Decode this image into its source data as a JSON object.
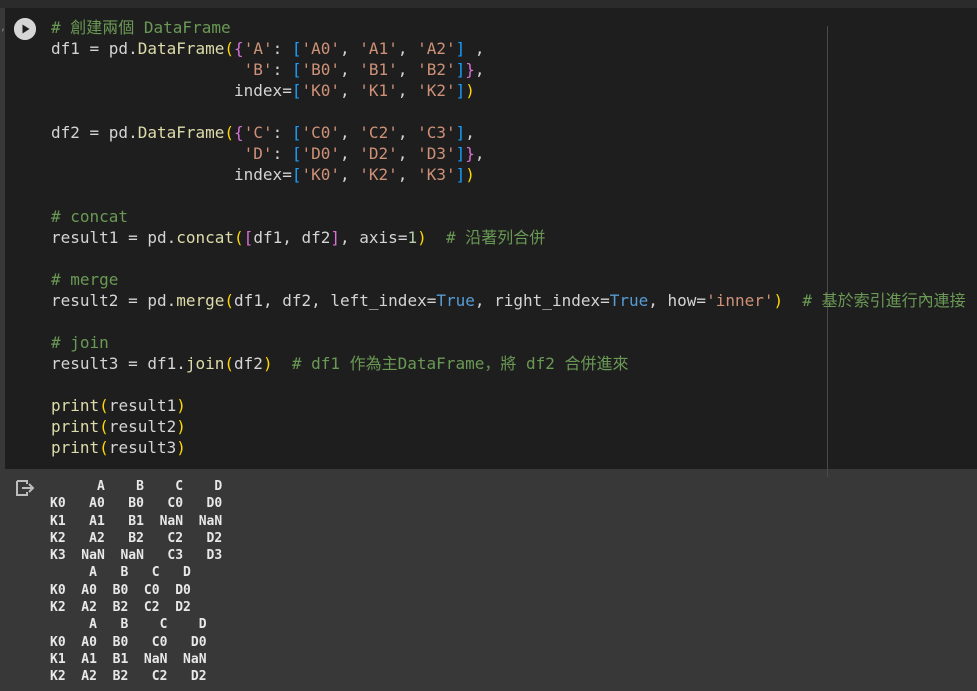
{
  "cell": {
    "code_lines": [
      [
        [
          "c",
          "# 創建兩個 DataFrame"
        ]
      ],
      [
        [
          "",
          "df1 = pd."
        ],
        [
          "f",
          "DataFrame"
        ],
        [
          "y",
          "("
        ],
        [
          "m",
          "{"
        ],
        [
          "s",
          "'A'"
        ],
        [
          "",
          ": "
        ],
        [
          "b",
          "["
        ],
        [
          "s",
          "'A0'"
        ],
        [
          "",
          ", "
        ],
        [
          "s",
          "'A1'"
        ],
        [
          "",
          ", "
        ],
        [
          "s",
          "'A2'"
        ],
        [
          "b",
          "]"
        ],
        [
          "",
          " ,"
        ]
      ],
      [
        [
          "",
          "                    "
        ],
        [
          "s",
          "'B'"
        ],
        [
          "",
          ": "
        ],
        [
          "b",
          "["
        ],
        [
          "s",
          "'B0'"
        ],
        [
          "",
          ", "
        ],
        [
          "s",
          "'B1'"
        ],
        [
          "",
          ", "
        ],
        [
          "s",
          "'B2'"
        ],
        [
          "b",
          "]"
        ],
        [
          "m",
          "}"
        ],
        [
          "",
          ","
        ]
      ],
      [
        [
          "",
          "                   index="
        ],
        [
          "b",
          "["
        ],
        [
          "s",
          "'K0'"
        ],
        [
          "",
          ", "
        ],
        [
          "s",
          "'K1'"
        ],
        [
          "",
          ", "
        ],
        [
          "s",
          "'K2'"
        ],
        [
          "b",
          "]"
        ],
        [
          "y",
          ")"
        ]
      ],
      [],
      [
        [
          "",
          "df2 = pd."
        ],
        [
          "f",
          "DataFrame"
        ],
        [
          "y",
          "("
        ],
        [
          "m",
          "{"
        ],
        [
          "s",
          "'C'"
        ],
        [
          "",
          ": "
        ],
        [
          "b",
          "["
        ],
        [
          "s",
          "'C0'"
        ],
        [
          "",
          ", "
        ],
        [
          "s",
          "'C2'"
        ],
        [
          "",
          ", "
        ],
        [
          "s",
          "'C3'"
        ],
        [
          "b",
          "]"
        ],
        [
          "",
          ","
        ]
      ],
      [
        [
          "",
          "                    "
        ],
        [
          "s",
          "'D'"
        ],
        [
          "",
          ": "
        ],
        [
          "b",
          "["
        ],
        [
          "s",
          "'D0'"
        ],
        [
          "",
          ", "
        ],
        [
          "s",
          "'D2'"
        ],
        [
          "",
          ", "
        ],
        [
          "s",
          "'D3'"
        ],
        [
          "b",
          "]"
        ],
        [
          "m",
          "}"
        ],
        [
          "",
          ","
        ]
      ],
      [
        [
          "",
          "                   index="
        ],
        [
          "b",
          "["
        ],
        [
          "s",
          "'K0'"
        ],
        [
          "",
          ", "
        ],
        [
          "s",
          "'K2'"
        ],
        [
          "",
          ", "
        ],
        [
          "s",
          "'K3'"
        ],
        [
          "b",
          "]"
        ],
        [
          "y",
          ")"
        ]
      ],
      [],
      [
        [
          "c",
          "# concat"
        ]
      ],
      [
        [
          "",
          "result1 = pd."
        ],
        [
          "f",
          "concat"
        ],
        [
          "y",
          "("
        ],
        [
          "m",
          "["
        ],
        [
          "",
          "df1, df2"
        ],
        [
          "m",
          "]"
        ],
        [
          "",
          ", axis="
        ],
        [
          "n",
          "1"
        ],
        [
          "y",
          ")"
        ],
        [
          "",
          "  "
        ],
        [
          "c",
          "# 沿著列合併"
        ]
      ],
      [],
      [
        [
          "c",
          "# merge"
        ]
      ],
      [
        [
          "",
          "result2 = pd."
        ],
        [
          "f",
          "merge"
        ],
        [
          "y",
          "("
        ],
        [
          "",
          "df1, df2, left_index="
        ],
        [
          "k",
          "True"
        ],
        [
          "",
          ", right_index="
        ],
        [
          "k",
          "True"
        ],
        [
          "",
          ", how="
        ],
        [
          "s",
          "'inner'"
        ],
        [
          "y",
          ")"
        ],
        [
          "",
          "  "
        ],
        [
          "c",
          "# 基於索引進行內連接"
        ]
      ],
      [],
      [
        [
          "c",
          "# join"
        ]
      ],
      [
        [
          "",
          "result3 = df1."
        ],
        [
          "f",
          "join"
        ],
        [
          "y",
          "("
        ],
        [
          "",
          "df2"
        ],
        [
          "y",
          ")"
        ],
        [
          "",
          "  "
        ],
        [
          "c",
          "# df1 作為主DataFrame，將 df2 合併進來"
        ]
      ],
      [],
      [
        [
          "f",
          "print"
        ],
        [
          "y",
          "("
        ],
        [
          "",
          "result1"
        ],
        [
          "y",
          ")"
        ]
      ],
      [
        [
          "f",
          "print"
        ],
        [
          "y",
          "("
        ],
        [
          "",
          "result2"
        ],
        [
          "y",
          ")"
        ]
      ],
      [
        [
          "f",
          "print"
        ],
        [
          "y",
          "("
        ],
        [
          "",
          "result3"
        ],
        [
          "y",
          ")"
        ]
      ]
    ]
  },
  "output": {
    "text": "      A    B    C    D\nK0   A0   B0   C0   D0\nK1   A1   B1  NaN  NaN\nK2   A2   B2   C2   D2\nK3  NaN  NaN   C3   D3\n     A   B   C   D\nK0  A0  B0  C0  D0\nK2  A2  B2  C2  D2\n     A   B    C    D\nK0  A0  B0   C0   D0\nK1  A1  B1  NaN  NaN\nK2  A2  B2   C2   D2"
  },
  "colors": {
    "cell_bg": "#1e1e1e",
    "page_bg": "#383838",
    "comment": "#6a9955",
    "string": "#ce9178",
    "keyword": "#569cd6",
    "function": "#dcdcaa"
  },
  "icons": {
    "run": "play-circle-icon",
    "output": "output-redirect-icon"
  }
}
